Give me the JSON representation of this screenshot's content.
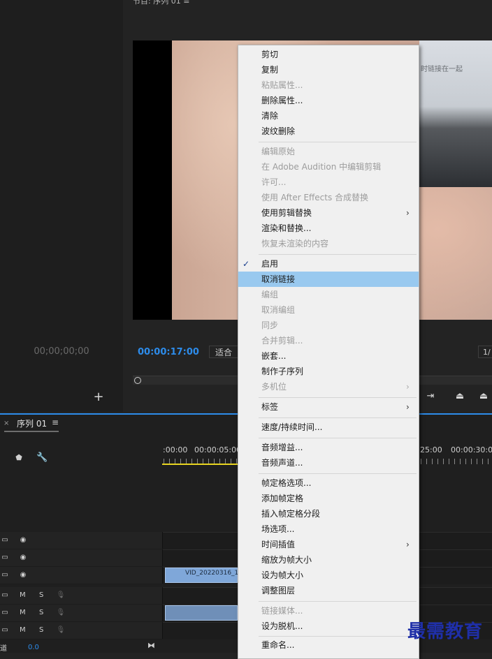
{
  "source_monitor": {
    "timecode": "00;00;00;00",
    "add_icon": "plus-icon"
  },
  "program_monitor": {
    "title": "节目: 序列 01  ≡",
    "video_caption": "时链接在一起",
    "timecode": "00:00:17:00",
    "fit_label": "适合",
    "resolution_label": "1/",
    "toolbar_icons": [
      "insert-icon",
      "lift-icon",
      "extract-icon"
    ]
  },
  "timeline": {
    "close_glyph": "×",
    "sequence_tab": "序列 01",
    "menu_glyph": "≡",
    "ruler_labels": [
      ":00:00",
      "00:00:05:00",
      "25:00",
      "00:00:30:00"
    ],
    "video_tracks": [
      {
        "icons": [
          "film-icon",
          "eye-icon"
        ]
      },
      {
        "icons": [
          "film-icon",
          "eye-icon"
        ]
      },
      {
        "icons": [
          "film-icon",
          "eye-icon"
        ],
        "clip_name": "VID_20220316_14"
      }
    ],
    "audio_tracks": [
      {
        "m": "M",
        "s": "S"
      },
      {
        "m": "M",
        "s": "S"
      },
      {
        "m": "M",
        "s": "S"
      }
    ],
    "bottom_value": "0.0",
    "bottom_left_glyph": "道"
  },
  "context_menu": {
    "items": [
      {
        "label": "剪切",
        "enabled": true
      },
      {
        "label": "复制",
        "enabled": true
      },
      {
        "label": "粘贴属性...",
        "enabled": false
      },
      {
        "label": "删除属性...",
        "enabled": true
      },
      {
        "label": "清除",
        "enabled": true
      },
      {
        "label": "波纹删除",
        "enabled": true
      },
      {
        "label": "编辑原始",
        "enabled": false
      },
      {
        "label": "在 Adobe Audition 中编辑剪辑",
        "enabled": false
      },
      {
        "label": "许可...",
        "enabled": false
      },
      {
        "label": "使用 After Effects 合成替换",
        "enabled": false
      },
      {
        "label": "使用剪辑替换",
        "enabled": true,
        "submenu": true
      },
      {
        "label": "渲染和替换...",
        "enabled": true
      },
      {
        "label": "恢复未渲染的内容",
        "enabled": false
      },
      {
        "label": "启用",
        "enabled": true,
        "checked": true
      },
      {
        "label": "取消链接",
        "enabled": true,
        "highlighted": true
      },
      {
        "label": "编组",
        "enabled": false
      },
      {
        "label": "取消编组",
        "enabled": false
      },
      {
        "label": "同步",
        "enabled": false
      },
      {
        "label": "合并剪辑...",
        "enabled": false
      },
      {
        "label": "嵌套...",
        "enabled": true
      },
      {
        "label": "制作子序列",
        "enabled": true
      },
      {
        "label": "多机位",
        "enabled": false,
        "submenu": true
      },
      {
        "label": "标签",
        "enabled": true,
        "submenu": true
      },
      {
        "label": "速度/持续时间...",
        "enabled": true
      },
      {
        "label": "音频增益...",
        "enabled": true
      },
      {
        "label": "音频声道...",
        "enabled": true
      },
      {
        "label": "帧定格选项...",
        "enabled": true
      },
      {
        "label": "添加帧定格",
        "enabled": true
      },
      {
        "label": "插入帧定格分段",
        "enabled": true
      },
      {
        "label": "场选项...",
        "enabled": true
      },
      {
        "label": "时间插值",
        "enabled": true,
        "submenu": true
      },
      {
        "label": "缩放为帧大小",
        "enabled": true
      },
      {
        "label": "设为帧大小",
        "enabled": true
      },
      {
        "label": "调整图层",
        "enabled": true
      },
      {
        "label": "链接媒体...",
        "enabled": false
      },
      {
        "label": "设为脱机...",
        "enabled": true
      },
      {
        "label": "重命名...",
        "enabled": true
      }
    ],
    "check_glyph": "✓",
    "submenu_glyph": "›"
  },
  "watermark": "最需教育"
}
